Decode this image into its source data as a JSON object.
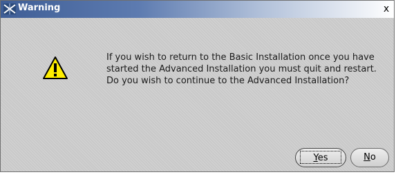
{
  "dialog": {
    "title": "Warning",
    "close_glyph": "x",
    "message": "If you wish to return to the Basic Installation once you have started the Advanced Installation you must quit and restart. Do you wish to continue to the Advanced Installation?",
    "icon": "warning-icon",
    "buttons": {
      "yes": {
        "mnemonic": "Y",
        "rest": "es"
      },
      "no": {
        "mnemonic": "N",
        "rest": "o"
      }
    }
  },
  "colors": {
    "title_bar_start": "#3f5e96",
    "dialog_background": "#c9c9c9",
    "warning_fill": "#ffee00"
  }
}
